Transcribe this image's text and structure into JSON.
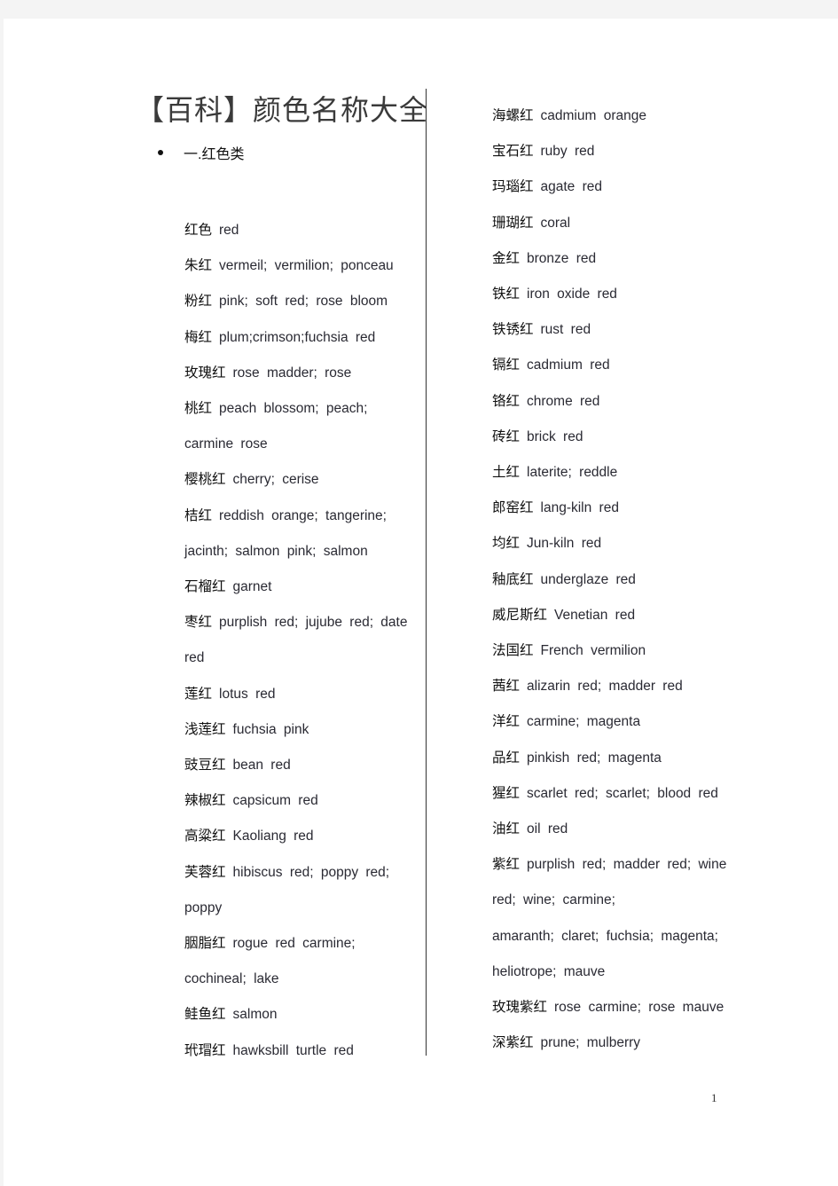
{
  "document": {
    "title": "【百科】颜色名称大全",
    "section_heading": "一.红色类",
    "page_number": "1",
    "left_column": [
      {
        "zh": "红色",
        "en": "red"
      },
      {
        "zh": "朱红",
        "en": "vermeil; vermilion; ponceau"
      },
      {
        "zh": "粉红",
        "en": "pink; soft red; rose bloom"
      },
      {
        "zh": "梅红",
        "en": "plum;crimson;fuchsia red"
      },
      {
        "zh": "玫瑰红",
        "en": "rose madder; rose"
      },
      {
        "zh": "桃红",
        "en": "peach blossom; peach;"
      },
      {
        "zh": "",
        "en": "carmine rose"
      },
      {
        "zh": "樱桃红",
        "en": "cherry; cerise"
      },
      {
        "zh": "桔红",
        "en": "reddish orange; tangerine;"
      },
      {
        "zh": "",
        "en": "jacinth; salmon pink; salmon"
      },
      {
        "zh": "石榴红",
        "en": "garnet"
      },
      {
        "zh": "枣红",
        "en": "purplish red; jujube red; date"
      },
      {
        "zh": "",
        "en": "red"
      },
      {
        "zh": "莲红",
        "en": "lotus red"
      },
      {
        "zh": "浅莲红",
        "en": "fuchsia pink"
      },
      {
        "zh": "豉豆红",
        "en": "bean red"
      },
      {
        "zh": "辣椒红",
        "en": "capsicum red"
      },
      {
        "zh": "高粱红",
        "en": "Kaoliang red"
      },
      {
        "zh": "芙蓉红",
        "en": "hibiscus red; poppy red;"
      },
      {
        "zh": "",
        "en": "poppy"
      },
      {
        "zh": "胭脂红",
        "en": "rogue red carmine;"
      },
      {
        "zh": "",
        "en": "cochineal; lake"
      },
      {
        "zh": "鲑鱼红",
        "en": "salmon"
      },
      {
        "zh": "玳瑁红",
        "en": "hawksbill turtle red"
      }
    ],
    "right_column": [
      {
        "zh": "海螺红",
        "en": "cadmium orange"
      },
      {
        "zh": "宝石红",
        "en": "ruby red"
      },
      {
        "zh": "玛瑙红",
        "en": "agate red"
      },
      {
        "zh": "珊瑚红",
        "en": "coral"
      },
      {
        "zh": "金红",
        "en": "bronze red"
      },
      {
        "zh": "铁红",
        "en": "iron oxide red"
      },
      {
        "zh": "铁锈红",
        "en": "rust red"
      },
      {
        "zh": "镉红",
        "en": "cadmium red"
      },
      {
        "zh": "铬红",
        "en": "chrome red"
      },
      {
        "zh": "砖红",
        "en": "brick red"
      },
      {
        "zh": "土红",
        "en": "laterite; reddle"
      },
      {
        "zh": "郎窑红",
        "en": "lang-kiln red"
      },
      {
        "zh": "均红",
        "en": "Jun-kiln red"
      },
      {
        "zh": "釉底红",
        "en": "underglaze red"
      },
      {
        "zh": "威尼斯红",
        "en": "Venetian red"
      },
      {
        "zh": "法国红",
        "en": "French vermilion"
      },
      {
        "zh": "茜红",
        "en": "alizarin red; madder red"
      },
      {
        "zh": "洋红",
        "en": "carmine; magenta"
      },
      {
        "zh": "品红",
        "en": "pinkish red; magenta"
      },
      {
        "zh": "猩红",
        "en": "scarlet red; scarlet; blood red"
      },
      {
        "zh": "油红",
        "en": "oil red"
      },
      {
        "zh": "紫红",
        "en": "purplish red; madder red; wine"
      },
      {
        "zh": "",
        "en": "red; wine; carmine;"
      },
      {
        "zh": "",
        "en": "amaranth; claret; fuchsia; magenta;"
      },
      {
        "zh": "",
        "en": "heliotrope; mauve"
      },
      {
        "zh": "玫瑰紫红",
        "en": "rose carmine; rose mauve"
      },
      {
        "zh": "深紫红",
        "en": "prune; mulberry"
      }
    ]
  }
}
